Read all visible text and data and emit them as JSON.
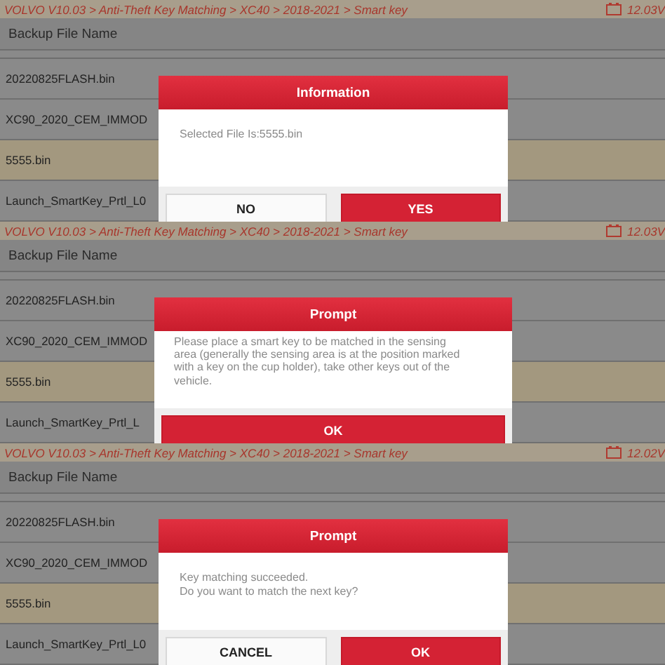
{
  "panels": [
    {
      "breadcrumb": "VOLVO V10.03 > Anti-Theft Key Matching > XC40 > 2018-2021 > Smart key",
      "voltage": "12.03V",
      "column": "Backup File Name",
      "rows": [
        {
          "name": "20220825FLASH.bin",
          "selected": false
        },
        {
          "name": "XC90_2020_CEM_IMMOD",
          "selected": false
        },
        {
          "name": "5555.bin",
          "selected": true
        },
        {
          "name": "Launch_SmartKey_Prtl_L0",
          "selected": false
        }
      ],
      "dialog": {
        "title": "Information",
        "message": "Selected File Is:5555.bin",
        "buttons": [
          {
            "label": "NO",
            "kind": "secondary"
          },
          {
            "label": "YES",
            "kind": "primary"
          }
        ]
      }
    },
    {
      "breadcrumb": "VOLVO V10.03 > Anti-Theft Key Matching > XC40 > 2018-2021 > Smart key",
      "voltage": "12.03V",
      "column": "Backup File Name",
      "rows": [
        {
          "name": "20220825FLASH.bin",
          "selected": false
        },
        {
          "name": "XC90_2020_CEM_IMMOD",
          "selected": false
        },
        {
          "name": "5555.bin",
          "selected": true
        },
        {
          "name": "Launch_SmartKey_Prtl_L",
          "selected": false
        }
      ],
      "dialog": {
        "title": "Prompt",
        "message": "Please place a smart key to be matched in the sensing area (generally the sensing area is at the position marked with a key on the cup holder), take other keys out of the vehicle.",
        "buttons": [
          {
            "label": "OK",
            "kind": "primary"
          }
        ]
      }
    },
    {
      "breadcrumb": "VOLVO V10.03 > Anti-Theft Key Matching > XC40 > 2018-2021 > Smart key",
      "voltage": "12.02V",
      "column": "Backup File Name",
      "rows": [
        {
          "name": "20220825FLASH.bin",
          "selected": false
        },
        {
          "name": "XC90_2020_CEM_IMMOD",
          "selected": false
        },
        {
          "name": "5555.bin",
          "selected": true
        },
        {
          "name": "Launch_SmartKey_Prtl_L0",
          "selected": false
        }
      ],
      "dialog": {
        "title": "Prompt",
        "message": "Key matching succeeded.\nDo you want to match the next key?",
        "buttons": [
          {
            "label": "CANCEL",
            "kind": "secondary"
          },
          {
            "label": "OK",
            "kind": "primary"
          }
        ]
      }
    }
  ]
}
